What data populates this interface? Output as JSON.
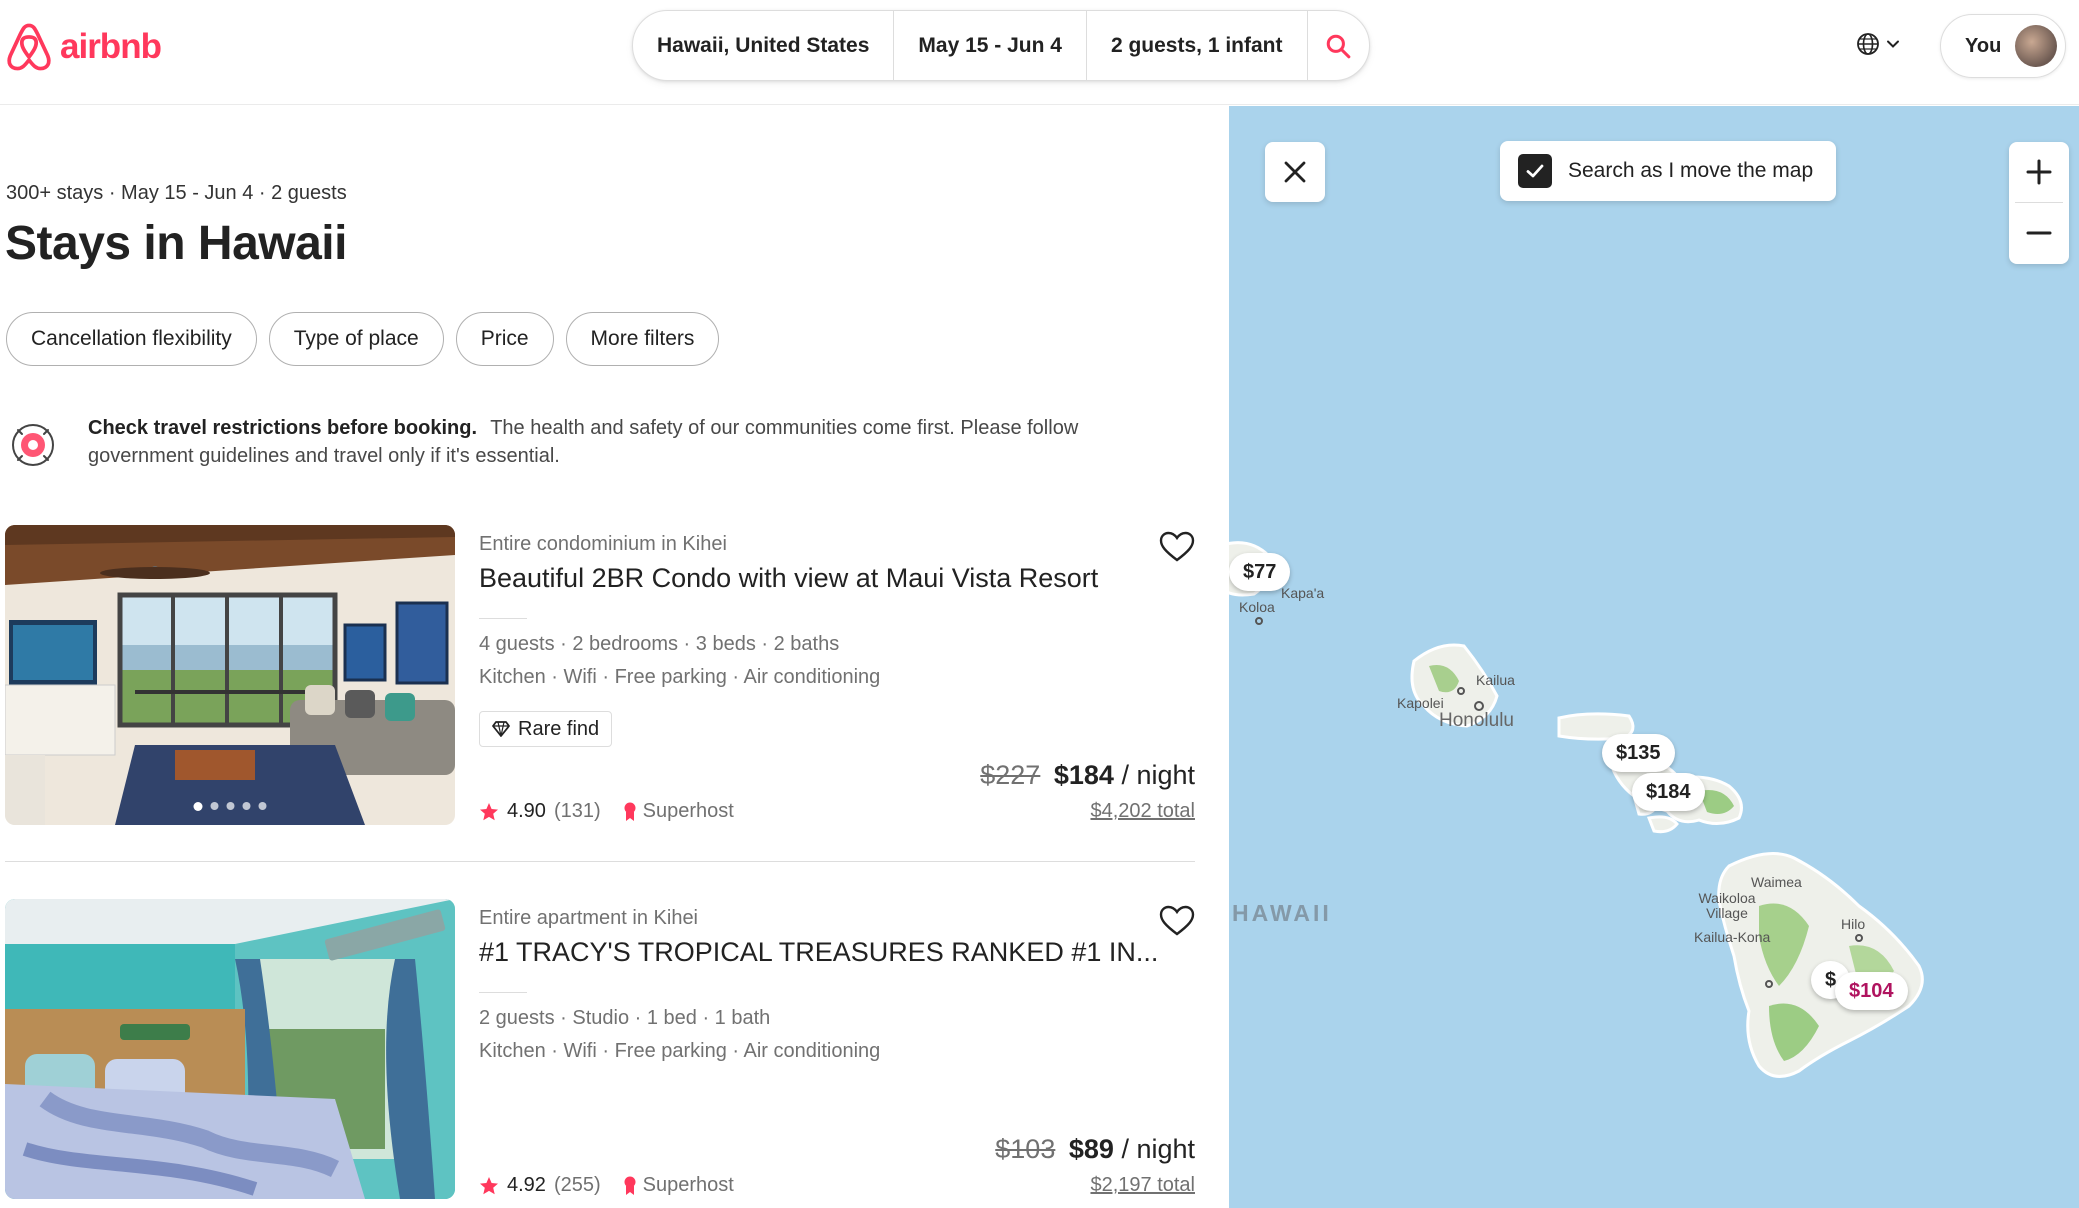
{
  "header": {
    "logo_text": "airbnb",
    "brand_color": "#FF385C",
    "search": {
      "location": "Hawaii, United States",
      "dates": "May 15 - Jun 4",
      "guests": "2 guests, 1 infant"
    },
    "user_label": "You"
  },
  "results": {
    "summary": "300+ stays · May 15 - Jun 4 · 2 guests",
    "title": "Stays in Hawaii",
    "filters": [
      "Cancellation flexibility",
      "Type of place",
      "Price",
      "More filters"
    ]
  },
  "notice": {
    "heading": "Check travel restrictions before booking.",
    "body": "The health and safety of our communities come first. Please follow government guidelines and travel only if it's essential."
  },
  "listings": [
    {
      "type": "Entire condominium in Kihei",
      "title": "Beautiful 2BR Condo with view at Maui Vista Resort",
      "specs": "4 guests · 2 bedrooms · 3 beds · 2 baths",
      "amenities": "Kitchen · Wifi · Free parking · Air conditioning",
      "badge": "Rare find",
      "rating": "4.90",
      "reviews": "(131)",
      "host_status": "Superhost",
      "old_price": "$227",
      "price": "$184",
      "per": "/ night",
      "total": "$4,202 total"
    },
    {
      "type": "Entire apartment in Kihei",
      "title": "#1 TRACY'S TROPICAL TREASURES RANKED #1 IN...",
      "specs": "2 guests · Studio · 1 bed · 1 bath",
      "amenities": "Kitchen · Wifi · Free parking · Air conditioning",
      "rating": "4.92",
      "reviews": "(255)",
      "host_status": "Superhost",
      "old_price": "$103",
      "price": "$89",
      "per": "/ night",
      "total": "$2,197 total"
    }
  ],
  "map": {
    "search_as_move": "Search as I move the map",
    "search_as_move_checked": true,
    "region_label": "HAWAII",
    "place_labels": [
      "Kapa'a",
      "Koloa",
      "Kailua",
      "Kapolei",
      "Honolulu",
      "Waimea",
      "Waikoloa Village",
      "Kailua-Kona",
      "Hilo"
    ],
    "pins": [
      "$77",
      "$135",
      "$184",
      "$",
      "$104"
    ],
    "ocean_color": "#AAD3EC"
  }
}
